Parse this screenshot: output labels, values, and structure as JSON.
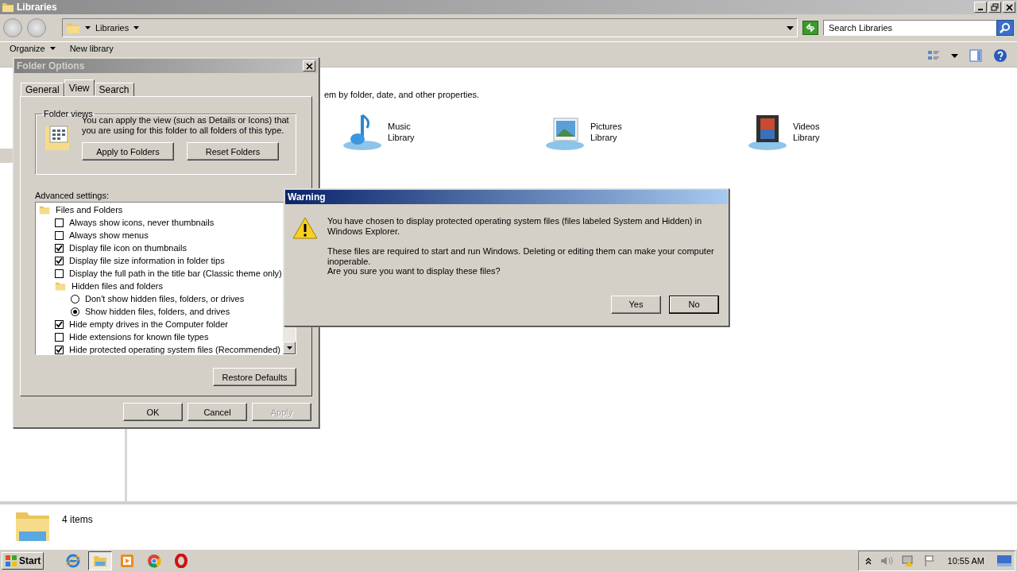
{
  "window": {
    "title": "Libraries"
  },
  "address": {
    "path": "Libraries"
  },
  "search": {
    "placeholder": "Search Libraries"
  },
  "toolbar": {
    "items": [
      {
        "label": "Organize",
        "kind": "menu"
      },
      {
        "label": "New library",
        "kind": "action"
      }
    ]
  },
  "content": {
    "description": "em by folder, date, and other properties.",
    "libraries": [
      {
        "kind": "music",
        "name": "Music",
        "subtitle": "Library"
      },
      {
        "kind": "pictures",
        "name": "Pictures",
        "subtitle": "Library"
      },
      {
        "kind": "videos",
        "name": "Videos",
        "subtitle": "Library"
      }
    ]
  },
  "status_bar": {
    "count": "4 items"
  },
  "folder_options": {
    "title": "Folder Options",
    "tabs": [
      {
        "label": "General",
        "selected": false
      },
      {
        "label": "View",
        "selected": true
      },
      {
        "label": "Search",
        "selected": false
      }
    ],
    "folder_views": {
      "legend": "Folder views",
      "text": "You can apply the view (such as Details or Icons) that you are using for this folder to all folders of this type.",
      "buttons": [
        "Apply to Folders",
        "Reset Folders"
      ]
    },
    "advanced_label": "Advanced settings:",
    "settings": [
      {
        "kind": "folder",
        "label": "Files and Folders",
        "children": [
          {
            "kind": "checkbox",
            "label": "Always show icons, never thumbnails",
            "checked": false
          },
          {
            "kind": "checkbox",
            "label": "Always show menus",
            "checked": false
          },
          {
            "kind": "checkbox",
            "label": "Display file icon on thumbnails",
            "checked": true
          },
          {
            "kind": "checkbox",
            "label": "Display file size information in folder tips",
            "checked": true
          },
          {
            "kind": "checkbox",
            "label": "Display the full path in the title bar (Classic theme only)",
            "checked": false
          },
          {
            "kind": "folder",
            "label": "Hidden files and folders",
            "children": [
              {
                "kind": "radio",
                "label": "Don't show hidden files, folders, or drives",
                "selected": false
              },
              {
                "kind": "radio",
                "label": "Show hidden files, folders, and drives",
                "selected": true
              }
            ]
          },
          {
            "kind": "checkbox",
            "label": "Hide empty drives in the Computer folder",
            "checked": true
          },
          {
            "kind": "checkbox",
            "label": "Hide extensions for known file types",
            "checked": false
          },
          {
            "kind": "checkbox",
            "label": "Hide protected operating system files (Recommended)",
            "checked": true
          }
        ]
      }
    ],
    "restore": "Restore Defaults",
    "buttons": [
      {
        "label": "OK",
        "disabled": false
      },
      {
        "label": "Cancel",
        "disabled": false
      },
      {
        "label": "Apply",
        "disabled": true
      }
    ]
  },
  "warning": {
    "title": "Warning",
    "paragraphs": [
      "You have chosen to display protected operating system files (files labeled System and Hidden) in Windows Explorer.",
      "These files are required to start and run Windows. Deleting or editing them can make your computer inoperable.",
      "Are you sure you want to display these files?"
    ],
    "buttons": [
      {
        "label": "Yes",
        "focused": false
      },
      {
        "label": "No",
        "focused": true
      }
    ]
  },
  "taskbar": {
    "start": "Start",
    "apps": [
      {
        "kind": "ie",
        "selected": false
      },
      {
        "kind": "explorer",
        "selected": true
      },
      {
        "kind": "media",
        "selected": false
      },
      {
        "kind": "chrome",
        "selected": false
      },
      {
        "kind": "opera",
        "selected": false
      }
    ],
    "clock": "10:55 AM"
  }
}
